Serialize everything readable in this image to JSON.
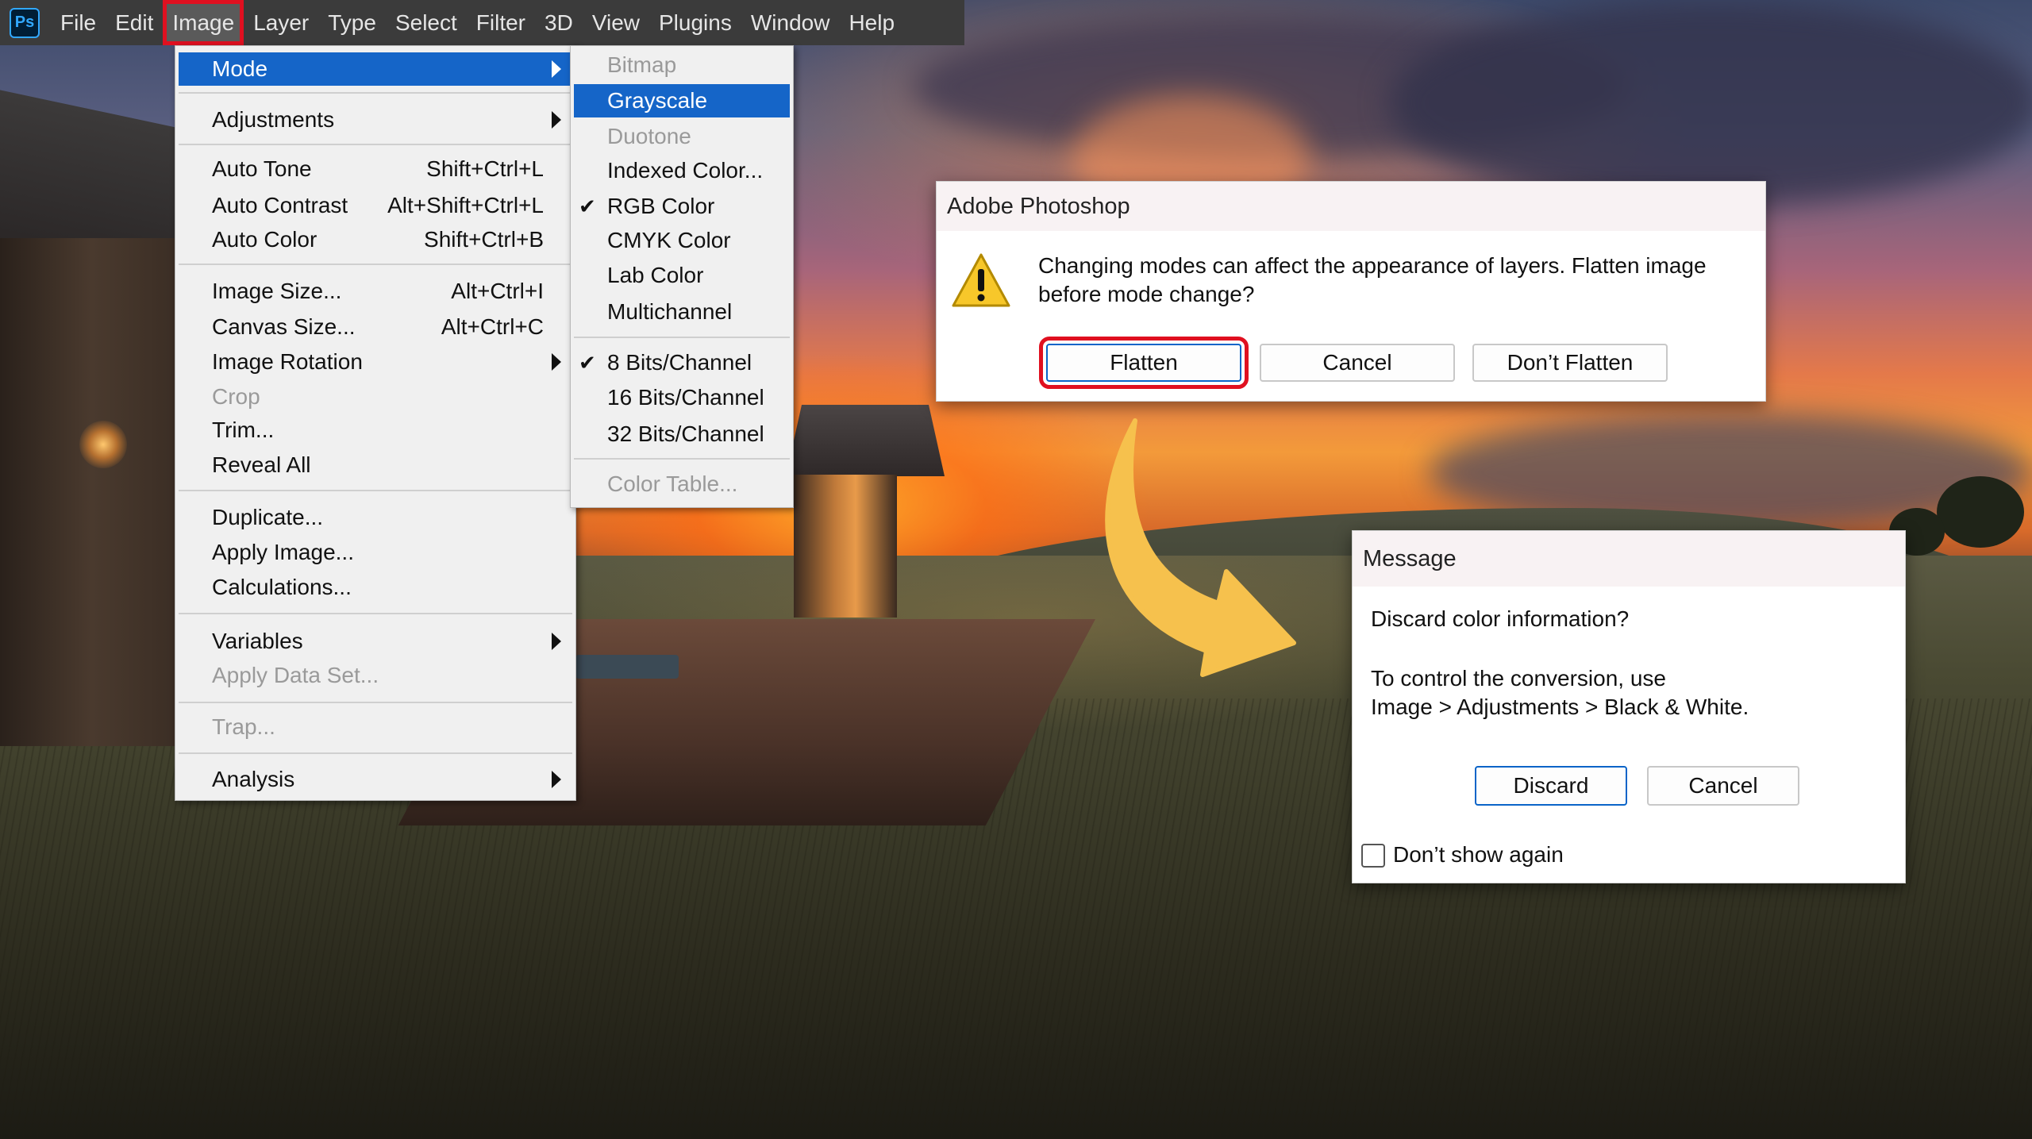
{
  "menubar": {
    "app_icon": "Ps",
    "items": [
      "File",
      "Edit",
      "Image",
      "Layer",
      "Type",
      "Select",
      "Filter",
      "3D",
      "View",
      "Plugins",
      "Window",
      "Help"
    ]
  },
  "image_menu": {
    "items": [
      {
        "label": "Mode"
      },
      {
        "label": "Adjustments"
      },
      {
        "label": "Auto Tone",
        "shortcut": "Shift+Ctrl+L"
      },
      {
        "label": "Auto Contrast",
        "shortcut": "Alt+Shift+Ctrl+L"
      },
      {
        "label": "Auto Color",
        "shortcut": "Shift+Ctrl+B"
      },
      {
        "label": "Image Size...",
        "shortcut": "Alt+Ctrl+I"
      },
      {
        "label": "Canvas Size...",
        "shortcut": "Alt+Ctrl+C"
      },
      {
        "label": "Image Rotation"
      },
      {
        "label": "Crop"
      },
      {
        "label": "Trim..."
      },
      {
        "label": "Reveal All"
      },
      {
        "label": "Duplicate..."
      },
      {
        "label": "Apply Image..."
      },
      {
        "label": "Calculations..."
      },
      {
        "label": "Variables"
      },
      {
        "label": "Apply Data Set..."
      },
      {
        "label": "Trap..."
      },
      {
        "label": "Analysis"
      }
    ]
  },
  "mode_menu": {
    "items": [
      {
        "label": "Bitmap"
      },
      {
        "label": "Grayscale"
      },
      {
        "label": "Duotone"
      },
      {
        "label": "Indexed Color..."
      },
      {
        "label": "RGB Color"
      },
      {
        "label": "CMYK Color"
      },
      {
        "label": "Lab Color"
      },
      {
        "label": "Multichannel"
      },
      {
        "label": "8 Bits/Channel"
      },
      {
        "label": "16 Bits/Channel"
      },
      {
        "label": "32 Bits/Channel"
      },
      {
        "label": "Color Table..."
      }
    ]
  },
  "flatten_dialog": {
    "title": "Adobe Photoshop",
    "message_line1": "Changing modes can affect the appearance of layers.  Flatten image",
    "message_line2": "before mode change?",
    "buttons": {
      "flatten": "Flatten",
      "cancel": "Cancel",
      "dont_flatten": "Don’t Flatten"
    }
  },
  "discard_dialog": {
    "title": "Message",
    "question": "Discard color information?",
    "hint_line1": "To control the conversion, use",
    "hint_line2": "Image > Adjustments > Black & White.",
    "buttons": {
      "discard": "Discard",
      "cancel": "Cancel"
    },
    "checkbox_label": "Don’t show again",
    "checkbox_checked": false
  },
  "colors": {
    "highlight_blue": "#1565c8",
    "annotation_red": "#e01020",
    "arrow_yellow": "#f6c14d",
    "menubar_bg": "#3b3b3b"
  },
  "icons": [
    "photoshop-logo-icon",
    "submenu-arrow-icon",
    "checkmark-icon",
    "warning-icon",
    "curved-arrow-icon"
  ]
}
